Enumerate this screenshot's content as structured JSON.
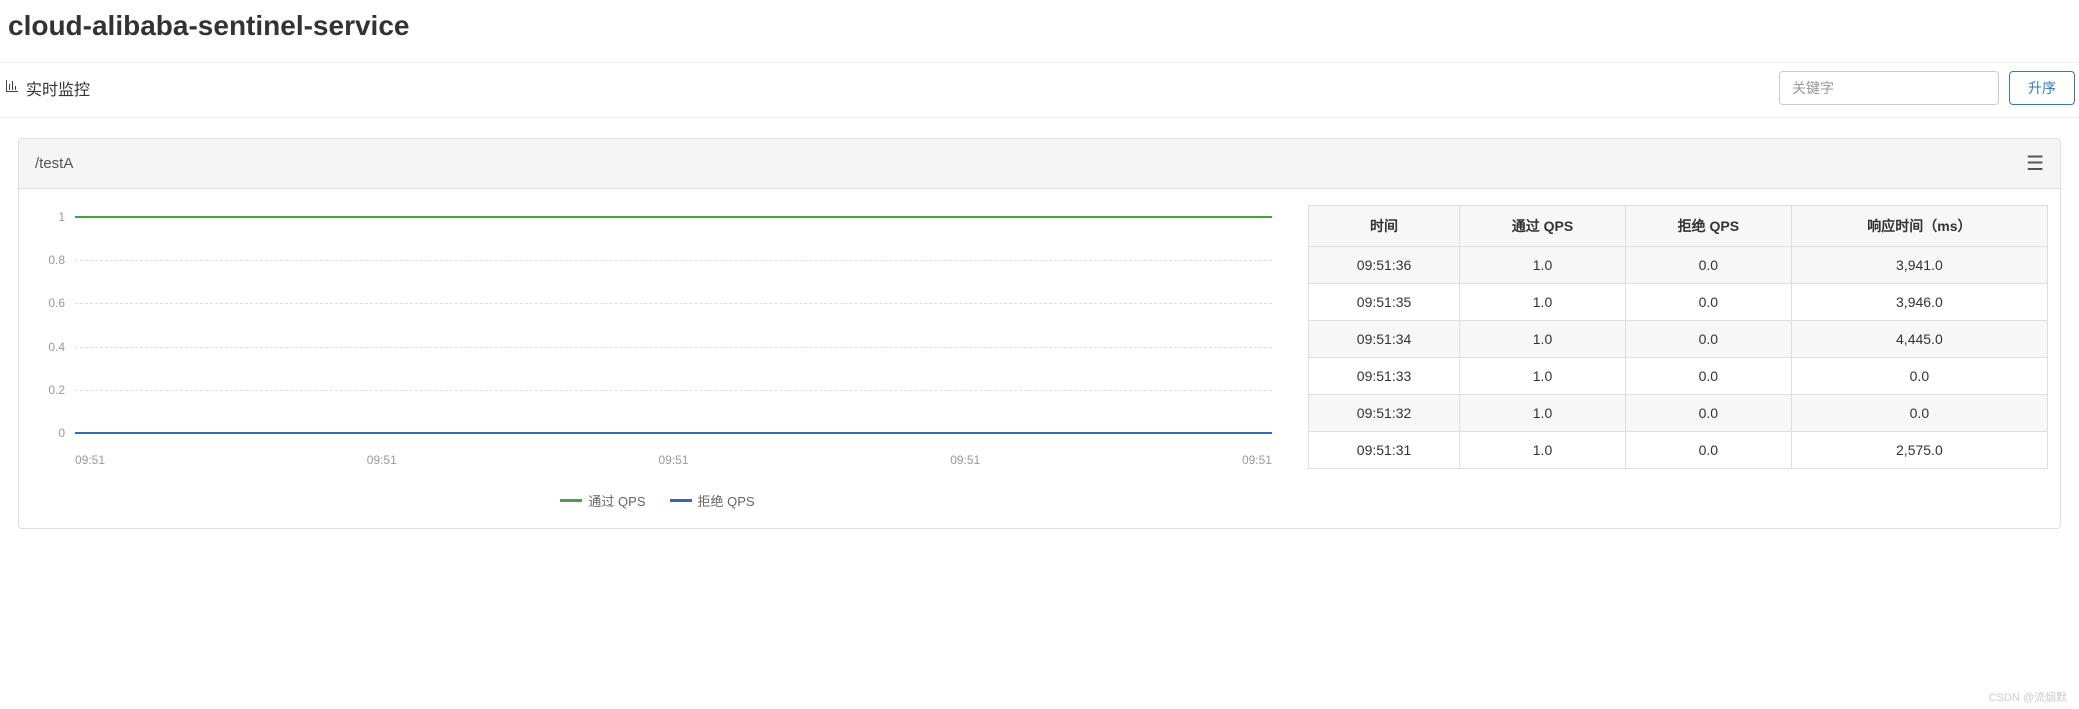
{
  "header": {
    "title": "cloud-alibaba-sentinel-service"
  },
  "toolbar": {
    "label": "实时监控",
    "search_placeholder": "关键字",
    "sort_label": "升序"
  },
  "panel": {
    "title": "/testA",
    "legend": {
      "pass": "通过 QPS",
      "block": "拒绝 QPS"
    },
    "colors": {
      "pass": "#4e9a4e",
      "block": "#3a67b5"
    }
  },
  "chart_data": {
    "type": "line",
    "x": [
      "09:51",
      "09:51",
      "09:51",
      "09:51",
      "09:51"
    ],
    "series": [
      {
        "name": "通过 QPS",
        "values": [
          1,
          1,
          1,
          1,
          1
        ],
        "color": "#4e9a4e"
      },
      {
        "name": "拒绝 QPS",
        "values": [
          0,
          0,
          0,
          0,
          0
        ],
        "color": "#3a67b5"
      }
    ],
    "ylim": [
      0,
      1
    ],
    "yticks": [
      0,
      0.2,
      0.4,
      0.6,
      0.8,
      1
    ],
    "xlabel": "",
    "ylabel": "",
    "title": ""
  },
  "table": {
    "headers": [
      "时间",
      "通过 QPS",
      "拒绝 QPS",
      "响应时间（ms）"
    ],
    "rows": [
      [
        "09:51:36",
        "1.0",
        "0.0",
        "3,941.0"
      ],
      [
        "09:51:35",
        "1.0",
        "0.0",
        "3,946.0"
      ],
      [
        "09:51:34",
        "1.0",
        "0.0",
        "4,445.0"
      ],
      [
        "09:51:33",
        "1.0",
        "0.0",
        "0.0"
      ],
      [
        "09:51:32",
        "1.0",
        "0.0",
        "0.0"
      ],
      [
        "09:51:31",
        "1.0",
        "0.0",
        "2,575.0"
      ]
    ]
  },
  "watermark": "CSDN @流烟默"
}
